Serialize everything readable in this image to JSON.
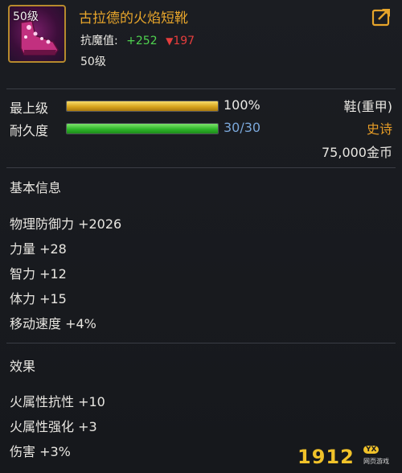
{
  "item": {
    "level_tag": "50级",
    "name": "古拉德的火焰短靴",
    "resist_label": "抗魔值:",
    "resist_up": "+252",
    "resist_down_arrow": "▼",
    "resist_down": "197",
    "level": "50级"
  },
  "bars": {
    "grade": {
      "label": "最上级",
      "value": "100%",
      "fill": 1.0
    },
    "durability": {
      "label": "耐久度",
      "value": "30/30",
      "fill": 1.0
    }
  },
  "info": {
    "type": "鞋(重甲)",
    "rarity": "史诗",
    "price": "75,000金币"
  },
  "basic_info": {
    "title": "基本信息",
    "stats": [
      "物理防御力 +2026",
      "力量 +28",
      "智力 +12",
      "体力 +15",
      "移动速度 +4%"
    ]
  },
  "effects": {
    "title": "效果",
    "stats": [
      "火属性抗性 +10",
      "火属性强化 +3",
      "伤害 +3%"
    ]
  },
  "watermark": {
    "digits": "1912",
    "badge": "YX",
    "sub": "网页游戏"
  },
  "icons": {
    "share": "share-icon",
    "item": "flame-boots-icon"
  },
  "colors": {
    "item_name": "#e7a52b",
    "epic": "#e49b26",
    "resist_up": "#4fd34f",
    "resist_down": "#e43d3d"
  }
}
